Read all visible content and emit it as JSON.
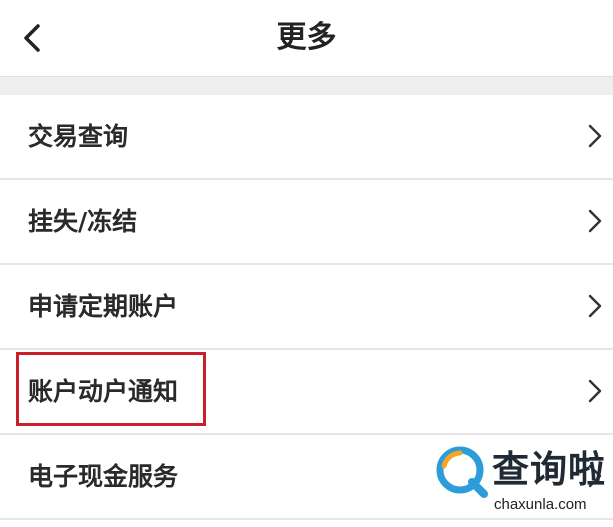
{
  "header": {
    "title": "更多",
    "back_icon": "chevron-left-icon"
  },
  "menu": {
    "items": [
      {
        "label": "交易查询"
      },
      {
        "label": "挂失/冻结"
      },
      {
        "label": "申请定期账户"
      },
      {
        "label": "账户动户通知"
      },
      {
        "label": "电子现金服务"
      }
    ],
    "chevron_icon": "chevron-right-icon"
  },
  "annotation": {
    "highlight_color": "#c8202a"
  },
  "watermark": {
    "name_cn": "查询啦",
    "domain": "chaxunla.com",
    "logo_colors": [
      "#2d9cdb",
      "#f5a623"
    ]
  }
}
